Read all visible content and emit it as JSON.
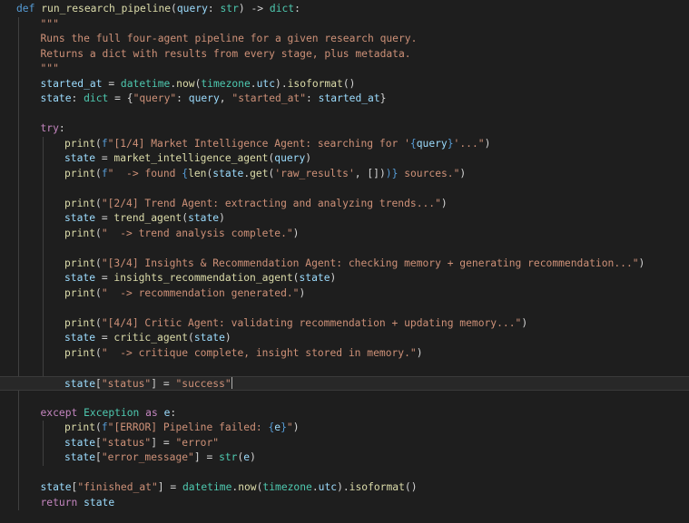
{
  "colors": {
    "background": "#1e1e1e",
    "keyword_control": "#c586c0",
    "keyword": "#569cd6",
    "function": "#dcdcaa",
    "string": "#ce9178",
    "variable": "#9cdcfe",
    "class": "#4ec9b0",
    "default": "#d4d4d4",
    "escape": "#d7ba7d"
  },
  "editor": {
    "active_line": 25,
    "lines": [
      {
        "indent": 0,
        "tokens": [
          [
            "def",
            "keyword"
          ],
          [
            " ",
            "default"
          ],
          [
            "run_research_pipeline",
            "function"
          ],
          [
            "(",
            "default"
          ],
          [
            "query",
            "variable"
          ],
          [
            ": ",
            "default"
          ],
          [
            "str",
            "class"
          ],
          [
            ") -> ",
            "default"
          ],
          [
            "dict",
            "class"
          ],
          [
            ":",
            "default"
          ]
        ]
      },
      {
        "indent": 1,
        "tokens": [
          [
            "\"\"\"",
            "string"
          ]
        ]
      },
      {
        "indent": 1,
        "tokens": [
          [
            "Runs the full four-agent pipeline for a given research query.",
            "string"
          ]
        ]
      },
      {
        "indent": 1,
        "tokens": [
          [
            "Returns a dict with results from every stage, plus metadata.",
            "string"
          ]
        ]
      },
      {
        "indent": 1,
        "tokens": [
          [
            "\"\"\"",
            "string"
          ]
        ]
      },
      {
        "indent": 1,
        "tokens": [
          [
            "started_at",
            "variable"
          ],
          [
            " = ",
            "default"
          ],
          [
            "datetime",
            "class"
          ],
          [
            ".",
            "default"
          ],
          [
            "now",
            "function"
          ],
          [
            "(",
            "default"
          ],
          [
            "timezone",
            "class"
          ],
          [
            ".",
            "default"
          ],
          [
            "utc",
            "variable"
          ],
          [
            ").",
            "default"
          ],
          [
            "isoformat",
            "function"
          ],
          [
            "()",
            "default"
          ]
        ]
      },
      {
        "indent": 1,
        "tokens": [
          [
            "state",
            "variable"
          ],
          [
            ": ",
            "default"
          ],
          [
            "dict",
            "class"
          ],
          [
            " = {",
            "default"
          ],
          [
            "\"query\"",
            "string"
          ],
          [
            ": ",
            "default"
          ],
          [
            "query",
            "variable"
          ],
          [
            ", ",
            "default"
          ],
          [
            "\"started_at\"",
            "string"
          ],
          [
            ": ",
            "default"
          ],
          [
            "started_at",
            "variable"
          ],
          [
            "}",
            "default"
          ]
        ]
      },
      {
        "indent": 0,
        "tokens": []
      },
      {
        "indent": 1,
        "tokens": [
          [
            "try",
            "keyword_control"
          ],
          [
            ":",
            "default"
          ]
        ]
      },
      {
        "indent": 2,
        "tokens": [
          [
            "print",
            "function"
          ],
          [
            "(",
            "default"
          ],
          [
            "f",
            "keyword"
          ],
          [
            "\"[1/4] Market Intelligence Agent: searching for '",
            "string"
          ],
          [
            "{",
            "keyword"
          ],
          [
            "query",
            "variable"
          ],
          [
            "}",
            "keyword"
          ],
          [
            "'...\"",
            "string"
          ],
          [
            ")",
            "default"
          ]
        ]
      },
      {
        "indent": 2,
        "tokens": [
          [
            "state",
            "variable"
          ],
          [
            " = ",
            "default"
          ],
          [
            "market_intelligence_agent",
            "function"
          ],
          [
            "(",
            "default"
          ],
          [
            "query",
            "variable"
          ],
          [
            ")",
            "default"
          ]
        ]
      },
      {
        "indent": 2,
        "tokens": [
          [
            "print",
            "function"
          ],
          [
            "(",
            "default"
          ],
          [
            "f",
            "keyword"
          ],
          [
            "\"  -> found ",
            "string"
          ],
          [
            "{",
            "keyword"
          ],
          [
            "len",
            "function"
          ],
          [
            "(",
            "default"
          ],
          [
            "state",
            "variable"
          ],
          [
            ".",
            "default"
          ],
          [
            "get",
            "function"
          ],
          [
            "(",
            "default"
          ],
          [
            "'raw_results'",
            "string"
          ],
          [
            ", [])",
            "default"
          ],
          [
            ")}",
            "keyword"
          ],
          [
            " sources.\"",
            "string"
          ],
          [
            ")",
            "default"
          ]
        ]
      },
      {
        "indent": 0,
        "tokens": []
      },
      {
        "indent": 2,
        "tokens": [
          [
            "print",
            "function"
          ],
          [
            "(",
            "default"
          ],
          [
            "\"[2/4] Trend Agent: extracting and analyzing trends...\"",
            "string"
          ],
          [
            ")",
            "default"
          ]
        ]
      },
      {
        "indent": 2,
        "tokens": [
          [
            "state",
            "variable"
          ],
          [
            " = ",
            "default"
          ],
          [
            "trend_agent",
            "function"
          ],
          [
            "(",
            "default"
          ],
          [
            "state",
            "variable"
          ],
          [
            ")",
            "default"
          ]
        ]
      },
      {
        "indent": 2,
        "tokens": [
          [
            "print",
            "function"
          ],
          [
            "(",
            "default"
          ],
          [
            "\"  -> trend analysis complete.\"",
            "string"
          ],
          [
            ")",
            "default"
          ]
        ]
      },
      {
        "indent": 0,
        "tokens": []
      },
      {
        "indent": 2,
        "tokens": [
          [
            "print",
            "function"
          ],
          [
            "(",
            "default"
          ],
          [
            "\"[3/4] Insights & Recommendation Agent: checking memory + generating recommendation...\"",
            "string"
          ],
          [
            ")",
            "default"
          ]
        ]
      },
      {
        "indent": 2,
        "tokens": [
          [
            "state",
            "variable"
          ],
          [
            " = ",
            "default"
          ],
          [
            "insights_recommendation_agent",
            "function"
          ],
          [
            "(",
            "default"
          ],
          [
            "state",
            "variable"
          ],
          [
            ")",
            "default"
          ]
        ]
      },
      {
        "indent": 2,
        "tokens": [
          [
            "print",
            "function"
          ],
          [
            "(",
            "default"
          ],
          [
            "\"  -> recommendation generated.\"",
            "string"
          ],
          [
            ")",
            "default"
          ]
        ]
      },
      {
        "indent": 0,
        "tokens": []
      },
      {
        "indent": 2,
        "tokens": [
          [
            "print",
            "function"
          ],
          [
            "(",
            "default"
          ],
          [
            "\"[4/4] Critic Agent: validating recommendation + updating memory...\"",
            "string"
          ],
          [
            ")",
            "default"
          ]
        ]
      },
      {
        "indent": 2,
        "tokens": [
          [
            "state",
            "variable"
          ],
          [
            " = ",
            "default"
          ],
          [
            "critic_agent",
            "function"
          ],
          [
            "(",
            "default"
          ],
          [
            "state",
            "variable"
          ],
          [
            ")",
            "default"
          ]
        ]
      },
      {
        "indent": 2,
        "tokens": [
          [
            "print",
            "function"
          ],
          [
            "(",
            "default"
          ],
          [
            "\"  -> critique complete, insight stored in memory.\"",
            "string"
          ],
          [
            ")",
            "default"
          ]
        ]
      },
      {
        "indent": 0,
        "tokens": []
      },
      {
        "indent": 2,
        "tokens": [
          [
            "state",
            "variable"
          ],
          [
            "[",
            "default"
          ],
          [
            "\"status\"",
            "string"
          ],
          [
            "] = ",
            "default"
          ],
          [
            "\"success\"",
            "string"
          ]
        ]
      },
      {
        "indent": 0,
        "tokens": []
      },
      {
        "indent": 1,
        "tokens": [
          [
            "except",
            "keyword_control"
          ],
          [
            " ",
            "default"
          ],
          [
            "Exception",
            "class"
          ],
          [
            " ",
            "default"
          ],
          [
            "as",
            "keyword_control"
          ],
          [
            " ",
            "default"
          ],
          [
            "e",
            "variable"
          ],
          [
            ":",
            "default"
          ]
        ]
      },
      {
        "indent": 2,
        "tokens": [
          [
            "print",
            "function"
          ],
          [
            "(",
            "default"
          ],
          [
            "f",
            "keyword"
          ],
          [
            "\"[ERROR] Pipeline failed: ",
            "string"
          ],
          [
            "{",
            "keyword"
          ],
          [
            "e",
            "variable"
          ],
          [
            "}",
            "keyword"
          ],
          [
            "\"",
            "string"
          ],
          [
            ")",
            "default"
          ]
        ]
      },
      {
        "indent": 2,
        "tokens": [
          [
            "state",
            "variable"
          ],
          [
            "[",
            "default"
          ],
          [
            "\"status\"",
            "string"
          ],
          [
            "] = ",
            "default"
          ],
          [
            "\"error\"",
            "string"
          ]
        ]
      },
      {
        "indent": 2,
        "tokens": [
          [
            "state",
            "variable"
          ],
          [
            "[",
            "default"
          ],
          [
            "\"error_message\"",
            "string"
          ],
          [
            "] = ",
            "default"
          ],
          [
            "str",
            "class"
          ],
          [
            "(",
            "default"
          ],
          [
            "e",
            "variable"
          ],
          [
            ")",
            "default"
          ]
        ]
      },
      {
        "indent": 0,
        "tokens": []
      },
      {
        "indent": 1,
        "tokens": [
          [
            "state",
            "variable"
          ],
          [
            "[",
            "default"
          ],
          [
            "\"finished_at\"",
            "string"
          ],
          [
            "] = ",
            "default"
          ],
          [
            "datetime",
            "class"
          ],
          [
            ".",
            "default"
          ],
          [
            "now",
            "function"
          ],
          [
            "(",
            "default"
          ],
          [
            "timezone",
            "class"
          ],
          [
            ".",
            "default"
          ],
          [
            "utc",
            "variable"
          ],
          [
            ").",
            "default"
          ],
          [
            "isoformat",
            "function"
          ],
          [
            "()",
            "default"
          ]
        ]
      },
      {
        "indent": 1,
        "tokens": [
          [
            "return",
            "keyword_control"
          ],
          [
            " ",
            "default"
          ],
          [
            "state",
            "variable"
          ]
        ]
      }
    ]
  }
}
